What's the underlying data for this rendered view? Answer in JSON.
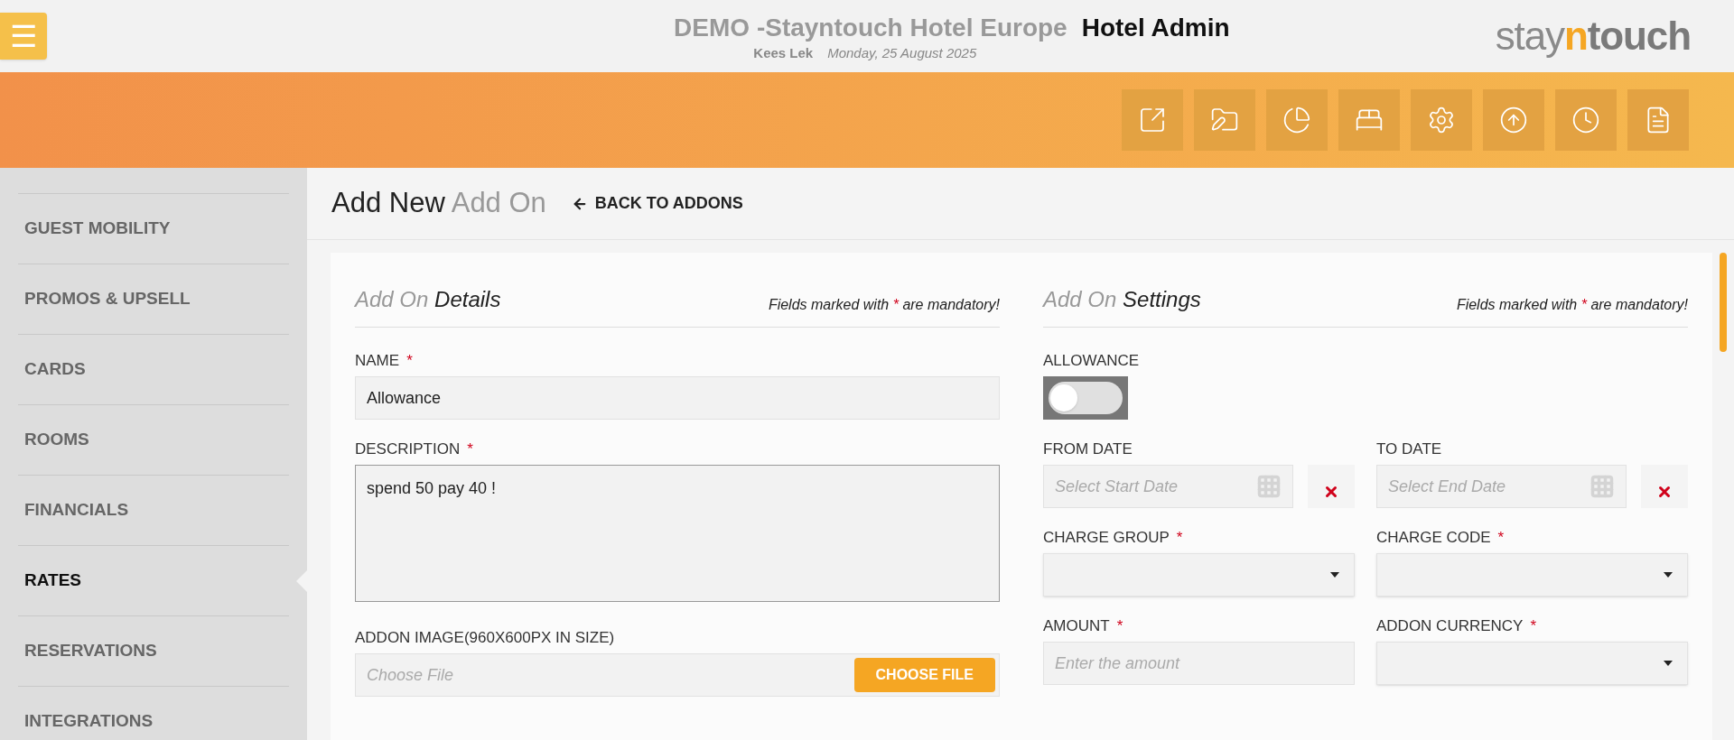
{
  "header": {
    "menu_button": "☰",
    "hotel": "DEMO -Stayntouch Hotel Europe",
    "app": "Hotel Admin",
    "user": "Kees Lek",
    "date": "Monday, 25 August 2025",
    "logo": [
      {
        "text": "stay",
        "kind": "light"
      },
      {
        "text": "n",
        "kind": "accent"
      },
      {
        "text": "touch",
        "kind": "bold"
      }
    ]
  },
  "toolbar": [
    {
      "kind": "open"
    },
    {
      "kind": "folder"
    },
    {
      "kind": "chart"
    },
    {
      "kind": "bed"
    },
    {
      "kind": "settings"
    },
    {
      "kind": "upload"
    },
    {
      "kind": "clock"
    },
    {
      "kind": "document"
    }
  ],
  "sidebar": {
    "items": [
      {
        "label": "GUEST MOBILITY",
        "selected": false
      },
      {
        "label": "PROMOS & UPSELL",
        "selected": false
      },
      {
        "label": "CARDS",
        "selected": false
      },
      {
        "label": "ROOMS",
        "selected": false
      },
      {
        "label": "FINANCIALS",
        "selected": false
      },
      {
        "label": "RATES",
        "selected": true
      },
      {
        "label": "RESERVATIONS",
        "selected": false
      },
      {
        "label": "INTEGRATIONS",
        "selected": false
      }
    ]
  },
  "page": {
    "title": "Add New",
    "title_muted": "Add On",
    "back_link": "BACK TO ADDONS"
  },
  "details": {
    "title_muted": "Add On",
    "title": "Details",
    "note": {
      "before": "Fields marked with",
      "mark": "*",
      "after": "are mandatory!"
    },
    "fields": [
      {
        "kind": "text",
        "label": "NAME",
        "mark": "*",
        "value": "Allowance"
      },
      {
        "kind": "textarea",
        "label": "DESCRIPTION",
        "mark": "*",
        "value": "spend 50 pay 40 !"
      },
      {
        "kind": "file",
        "label": "ADDON IMAGE(960X600PX IN SIZE)",
        "placeholder": "Choose File",
        "button": "CHOOSE FILE"
      }
    ]
  },
  "settings": {
    "title_muted": "Add On",
    "title": "Settings",
    "note": {
      "before": "Fields marked with",
      "mark": "*",
      "after": "are mandatory!"
    },
    "rows": [
      [
        {
          "kind": "toggle",
          "label": "ALLOWANCE",
          "on": false
        }
      ],
      [
        {
          "kind": "date",
          "label": "FROM DATE",
          "placeholder": "Select Start Date"
        },
        {
          "kind": "date",
          "label": "TO DATE",
          "placeholder": "Select End Date"
        }
      ],
      [
        {
          "kind": "select",
          "label": "CHARGE GROUP",
          "mark": "*"
        },
        {
          "kind": "select",
          "label": "CHARGE CODE",
          "mark": "*"
        }
      ],
      [
        {
          "kind": "text",
          "label": "AMOUNT",
          "mark": "*",
          "placeholder": "Enter the amount"
        },
        {
          "kind": "select",
          "label": "ADDON CURRENCY",
          "mark": "*"
        }
      ]
    ]
  }
}
